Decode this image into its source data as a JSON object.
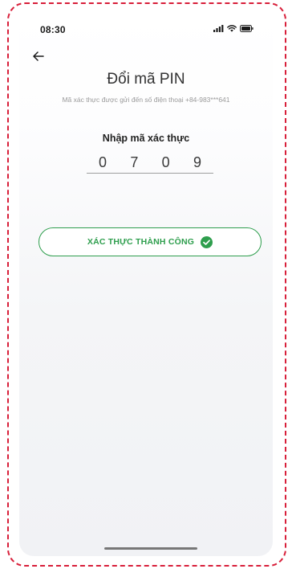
{
  "status_bar": {
    "time": "08:30"
  },
  "header": {
    "title": "Đổi mã PIN",
    "subtitle": "Mã xác thực được gửi đến số điện thoại +84-983***641"
  },
  "otp": {
    "label": "Nhập mã xác thực",
    "digits": [
      "0",
      "7",
      "0",
      "9"
    ]
  },
  "result_button": {
    "label": "XÁC THỰC THÀNH CÔNG",
    "icon": "check-circle-icon",
    "color": "#2e9e4d"
  },
  "colors": {
    "frame_border": "#d81f3a",
    "accent_green": "#2e9e4d"
  }
}
